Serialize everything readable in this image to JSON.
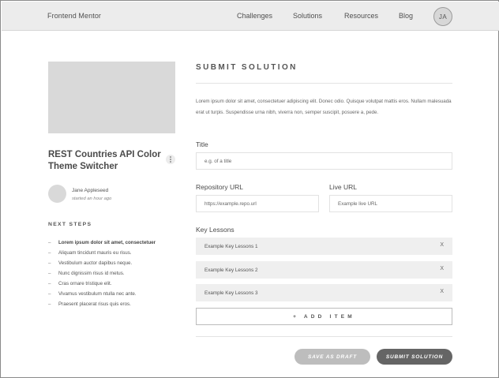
{
  "header": {
    "brand": "Frontend Mentor",
    "nav": [
      "Challenges",
      "Solutions",
      "Resources",
      "Blog"
    ],
    "avatar_initials": "JA"
  },
  "project": {
    "title": "REST Countries API Color Theme Switcher",
    "author_name": "Jane Appleseed",
    "author_time": "started an hour ago"
  },
  "next_steps": {
    "heading": "NEXT STEPS",
    "items": [
      "Lorem ipsum dolor sit amet, consectetuer",
      "Aliquam tincidunt mauris eu risus.",
      "Vestibulum auctor dapibus neque.",
      "Nunc dignissim risus id metus.",
      "Cras ornare tristique elit.",
      "Vivamus vestibulum ntulla nec ante.",
      "Praesent placerat risus quis eros."
    ]
  },
  "form": {
    "heading": "SUBMIT SOLUTION",
    "intro": "Lorem ipsum dolor sit amet, consectetuer adipiscing elit. Donec odio. Quisque volutpat mattis eros. Nullam malesuada erat ut turpis. Suspendisse urna nibh, viverra non, semper suscipit, posuere a, pede.",
    "title_label": "Title",
    "title_placeholder": "e.g. of a title",
    "repo_label": "Repository URL",
    "repo_value": "https://example.repo.url",
    "live_label": "Live URL",
    "live_value": "Example live URL",
    "lessons_label": "Key Lessons",
    "lessons": [
      "Example Key Lessons 1",
      "Example Key Lessons 2",
      "Example Key Lessons 3"
    ],
    "remove_glyph": "X",
    "add_item_label": "+ ADD ITEM",
    "save_draft_label": "SAVE AS DRAFT",
    "submit_label": "SUBMIT SOLUTION"
  }
}
